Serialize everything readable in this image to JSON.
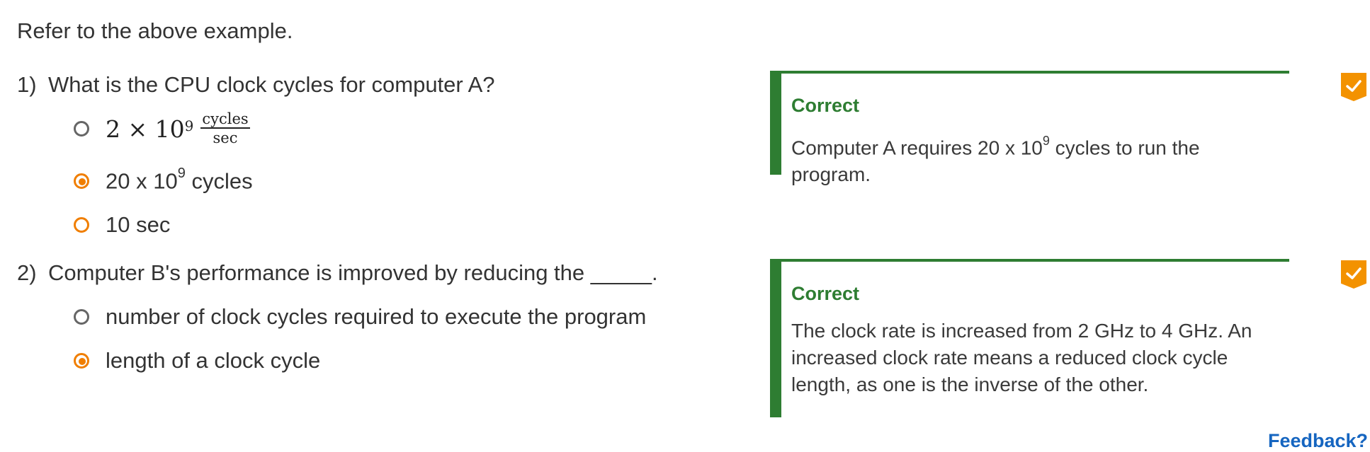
{
  "intro": "Refer to the above example.",
  "questions": [
    {
      "number": "1)",
      "text": "What is the CPU clock cycles for computer A?",
      "options": [
        {
          "math": {
            "base": "2 × 10",
            "exp": "9",
            "frac_num": "cycles",
            "frac_den": "sec"
          },
          "selected": false
        },
        {
          "label": "20 x 10",
          "sup": "9",
          "label_suffix": " cycles",
          "selected": true
        },
        {
          "label": "10 sec",
          "selected": false
        }
      ],
      "feedback": {
        "title": "Correct",
        "text_pre": "Computer A requires 20 x 10",
        "text_sup": "9",
        "text_post": " cycles to run the program."
      }
    },
    {
      "number": "2)",
      "text": "Computer B's performance is improved by reducing the _____.",
      "options": [
        {
          "label": "number of clock cycles required to execute the program",
          "selected": false
        },
        {
          "label": "length of a clock cycle",
          "selected": true
        }
      ],
      "feedback": {
        "title": "Correct",
        "text": "The clock rate is increased from 2 GHz to 4 GHz. An increased clock rate means a reduced clock cycle length, as one is the inverse of the other."
      }
    }
  ],
  "footer_link": "Feedback?",
  "colors": {
    "correct_green": "#2e7d32",
    "accent_orange": "#f07e00",
    "check_badge": "#f39200"
  }
}
